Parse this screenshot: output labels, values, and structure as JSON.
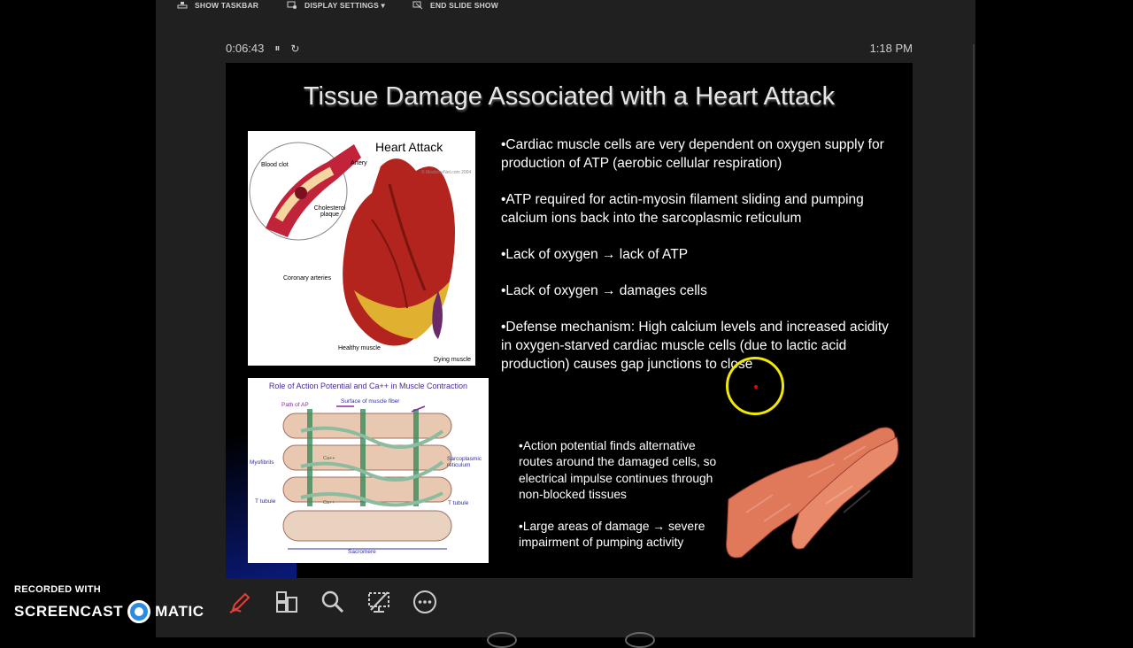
{
  "topbar": {
    "show_taskbar": "SHOW TASKBAR",
    "display_settings": "DISPLAY SETTINGS ▾",
    "end_slide_show": "END SLIDE SHOW"
  },
  "presenter": {
    "elapsed": "0:06:43",
    "pause_icon": "pause-icon",
    "restart_icon": "restart-icon",
    "clock": "1:18 PM"
  },
  "slide": {
    "title": "Tissue Damage Associated with a Heart Attack",
    "img1": {
      "heading": "Heart Attack",
      "labels": [
        "Blood clot",
        "Artery",
        "Cholesterol plaque",
        "Coronary arteries",
        "Healthy muscle",
        "Dying muscle"
      ],
      "credit": "© MedicineNet.com 2004"
    },
    "img2": {
      "heading": "Role of Action Potential and Ca++ in Muscle Contraction",
      "labels": [
        "Path of AP",
        "Surface of muscle fiber",
        "Myofibrils",
        "Sarcoplasmic reticulum",
        "T tubule",
        "T tubule",
        "Sacromere",
        "Ca++",
        "Ca++"
      ]
    },
    "bullets": [
      "•Cardiac muscle cells are very dependent on oxygen supply for production of ATP (aerobic cellular respiration)",
      "•ATP required for actin-myosin filament sliding and pumping calcium ions back into the sarcoplasmic reticulum",
      "•Lack of oxygen → lack of ATP",
      "•Lack of oxygen → damages cells",
      "•Defense mechanism:  High calcium levels and increased acidity in oxygen-starved cardiac muscle cells (due to lactic acid production) causes gap junctions to close"
    ],
    "sub_bullets": [
      "•Action potential finds alternative routes around the damaged cells, so electrical impulse continues through non-blocked tissues",
      "•Large areas of damage → severe impairment of pumping activity"
    ]
  },
  "toolbar": {
    "items": [
      "pen-icon",
      "slides-grid-icon",
      "zoom-icon",
      "screen-icon",
      "more-options-icon"
    ]
  },
  "watermark": {
    "line1": "RECORDED WITH",
    "left": "SCREENCAST",
    "right": "MATIC"
  },
  "colors": {
    "pen_accent": "#e0413a",
    "cursor_ring": "#f0e800"
  }
}
